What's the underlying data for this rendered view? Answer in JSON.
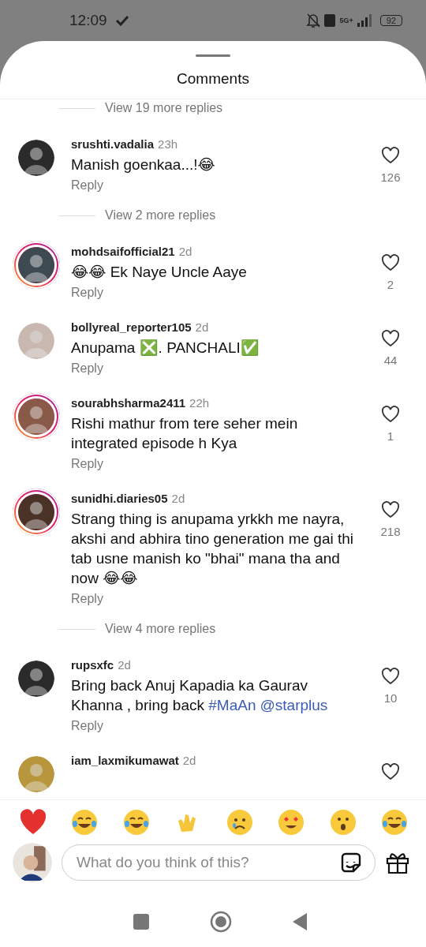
{
  "status_bar": {
    "time": "12:09",
    "network": "5G+",
    "battery": "92"
  },
  "sheet": {
    "title": "Comments"
  },
  "items": [
    {
      "kind": "more_replies",
      "label": "View 19 more replies"
    },
    {
      "kind": "comment",
      "username": "srushti.vadalia",
      "time": "23h",
      "text": "Manish goenkaa...!😂",
      "reply": "Reply",
      "likes": "126",
      "story_ring": false
    },
    {
      "kind": "more_replies",
      "label": "View 2 more replies"
    },
    {
      "kind": "comment",
      "username": "mohdsaifofficial21",
      "time": "2d",
      "text": "😂😂 Ek Naye Uncle Aaye",
      "reply": "Reply",
      "likes": "2",
      "story_ring": true
    },
    {
      "kind": "comment",
      "username": "bollyreal_reporter105",
      "time": "2d",
      "text": "Anupama ❎. PANCHALI✅",
      "reply": "Reply",
      "likes": "44",
      "story_ring": false
    },
    {
      "kind": "comment",
      "username": "sourabhsharma2411",
      "time": "22h",
      "text": "Rishi mathur from tere seher mein integrated episode h Kya",
      "reply": "Reply",
      "likes": "1",
      "story_ring": true
    },
    {
      "kind": "comment",
      "username": "sunidhi.diaries05",
      "time": "2d",
      "text": "Strang thing is anupama yrkkh me nayra, akshi and abhira tino generation me gai thi tab usne manish ko \"bhai\" mana tha and now 😂😂",
      "reply": "Reply",
      "likes": "218",
      "story_ring": true
    },
    {
      "kind": "more_replies",
      "label": "View 4 more replies"
    },
    {
      "kind": "comment",
      "username": "rupsxfc",
      "time": "2d",
      "text": "Bring back Anuj Kapadia ka Gaurav Khanna , bring back ",
      "tags": [
        "#MaAn",
        "@starplus"
      ],
      "reply": "Reply",
      "likes": "10",
      "story_ring": false
    },
    {
      "kind": "comment",
      "username": "iam_laxmikumawat",
      "time": "2d",
      "story_ring": false
    }
  ],
  "composer": {
    "placeholder": "What do you think of this?"
  }
}
